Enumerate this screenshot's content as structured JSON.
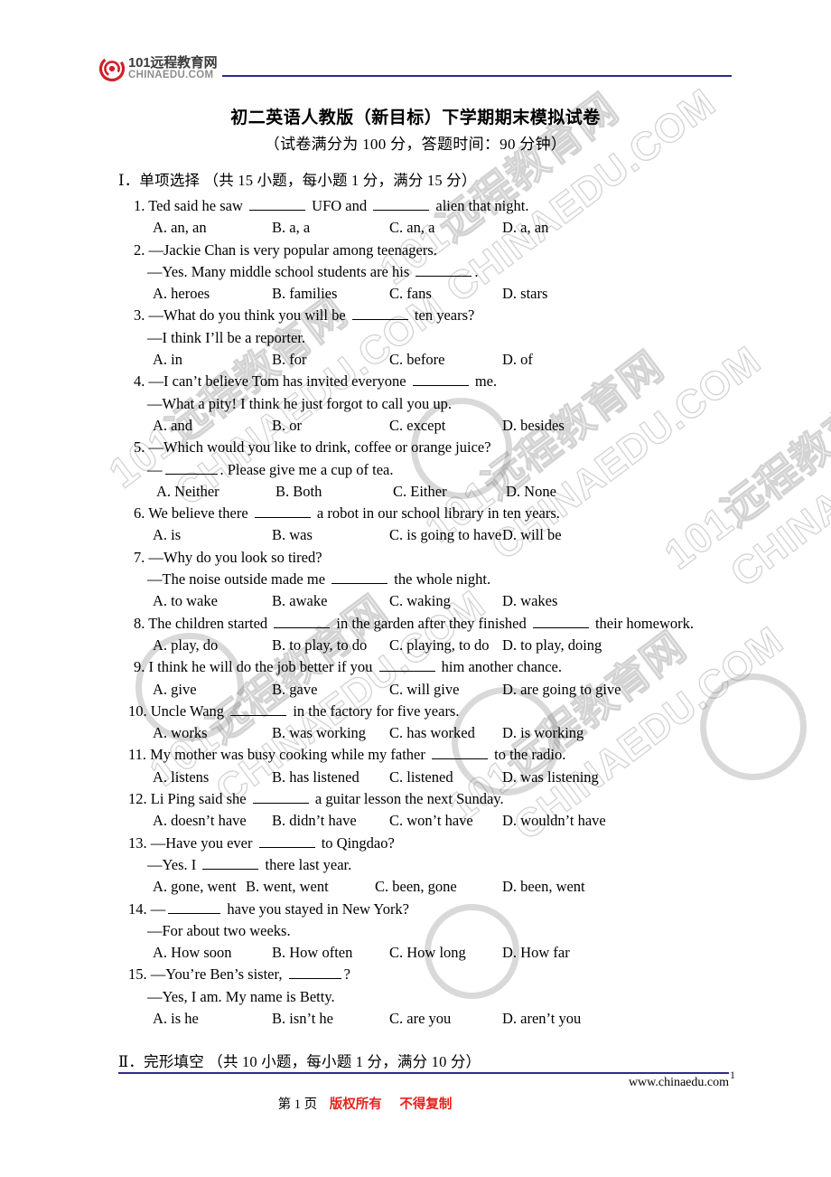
{
  "header": {
    "logo_cn": "101远程教育网",
    "logo_en": "CHINAEDU.COM",
    "logo_icon": "chinaedu-ring-logo",
    "rule_color": "#2e2a8f"
  },
  "title": "初二英语人教版（新目标）下学期期末模拟试卷",
  "subtitle": "（试卷满分为 100 分，答题时间：90 分钟）",
  "watermark": {
    "text_cn": "101远程教育网",
    "text_en": "CHINAEDU.COM"
  },
  "sections": [
    {
      "heading": "Ⅰ．单项选择 （共 15 小题，每小题 1 分，满分 15 分）"
    },
    {
      "heading": "Ⅱ．完形填空 （共 10 小题，每小题 1 分，满分 10 分）"
    }
  ],
  "questions": [
    {
      "num": "1.",
      "stem_a": "Ted said he saw",
      "stem_b": "UFO and",
      "stem_c": "alien that night.",
      "options": [
        "A. an, an",
        "B. a, a",
        "C. an, a",
        "D. a, an"
      ]
    },
    {
      "num": "2.",
      "line1": "—Jackie Chan is very popular among teenagers.",
      "line2_a": "—Yes. Many middle school students are his",
      "line2_b": ".",
      "options": [
        "A. heroes",
        "B. families",
        "C. fans",
        "D. stars"
      ]
    },
    {
      "num": "3.",
      "line1_a": "—What do you think you will be",
      "line1_b": "ten years?",
      "line2": "—I think I’ll be a reporter.",
      "options": [
        "A. in",
        "B. for",
        "C. before",
        "D. of"
      ]
    },
    {
      "num": "4.",
      "line1_a": "—I can’t believe Tom has invited everyone",
      "line1_b": "me.",
      "line2": "—What a pity! I think he just forgot to call you up.",
      "options": [
        "A. and",
        "B. or",
        "C. except",
        "D. besides"
      ]
    },
    {
      "num": "5.",
      "line1": "—Which would you like to drink, coffee or orange juice?",
      "line2_a": "—",
      "line2_b": ". Please give me a cup of tea.",
      "options": [
        "A. Neither",
        "B. Both",
        "C. Either",
        "D. None"
      ]
    },
    {
      "num": "6.",
      "stem_a": "We believe there",
      "stem_b": "a robot in our school library in ten years.",
      "options": [
        "A. is",
        "B. was",
        "C. is going to have",
        "D. will be"
      ]
    },
    {
      "num": "7.",
      "line1": "—Why do you look so tired?",
      "line2_a": "—The noise outside made me",
      "line2_b": "the whole night.",
      "options": [
        "A. to wake",
        "B. awake",
        "C. waking",
        "D. wakes"
      ]
    },
    {
      "num": "8.",
      "stem_a": "The children started",
      "stem_b": "in the garden after they finished",
      "stem_c": "their homework.",
      "options": [
        "A. play, do",
        "B. to play, to do",
        "C. playing, to do",
        "D. to play, doing"
      ]
    },
    {
      "num": "9.",
      "stem_a": "I think he will do the job better if you",
      "stem_b": "him another chance.",
      "options": [
        "A. give",
        "B. gave",
        "C. will give",
        "D. are going to give"
      ]
    },
    {
      "num": "10.",
      "stem_a": "Uncle Wang",
      "stem_b": "in the factory for five years.",
      "options": [
        "A. works",
        "B. was working",
        "C. has worked",
        "D. is working"
      ]
    },
    {
      "num": "11.",
      "stem_a": "My mother was busy cooking while my father",
      "stem_b": "to the radio.",
      "options": [
        "A. listens",
        "B. has listened",
        "C. listened",
        "D. was listening"
      ]
    },
    {
      "num": "12.",
      "stem_a": "Li Ping said she",
      "stem_b": "a guitar lesson the next Sunday.",
      "options": [
        "A. doesn’t have",
        "B. didn’t have",
        "C. won’t have",
        "D. wouldn’t have"
      ]
    },
    {
      "num": "13.",
      "line1_a": "—Have you ever",
      "line1_b": "to Qingdao?",
      "line2_a": "—Yes. I",
      "line2_b": "there last year.",
      "options": [
        "A. gone, went",
        "B. went, went",
        "C. been, gone",
        "D. been, went"
      ]
    },
    {
      "num": "14.",
      "line1_a": "—",
      "line1_b": "have you stayed in New York?",
      "line2": "—For about two weeks.",
      "options": [
        "A. How soon",
        "B. How often",
        "C. How long",
        "D. How far"
      ]
    },
    {
      "num": "15.",
      "line1_a": "—You’re Ben’s sister,",
      "line1_b": "?",
      "line2": "—Yes, I am. My name is Betty.",
      "options": [
        "A. is he",
        "B. isn’t he",
        "C. are you",
        "D. aren’t you"
      ]
    }
  ],
  "footer": {
    "url": "www.chinaedu.com",
    "page_label": "第 1 页",
    "copyright": "版权所有",
    "nocopy": "不得复制",
    "edge_num": "1",
    "copy_color": "#e8211c",
    "rule_color": "#2e2a8f"
  }
}
